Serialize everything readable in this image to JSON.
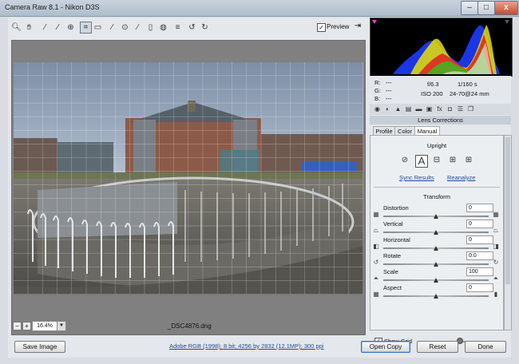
{
  "window": {
    "title": "Camera Raw 8.1  -  Nikon D3S",
    "minimize_label": "–",
    "maximize_label": "□",
    "close_label": "x"
  },
  "toolbar": {
    "tools": [
      "zoom-icon",
      "hand-icon",
      "white-balance-icon",
      "color-sampler-icon",
      "targeted-adjustment-icon",
      "crop-icon",
      "straighten-icon",
      "spot-removal-icon",
      "red-eye-icon",
      "adjustment-brush-icon",
      "graduated-filter-icon",
      "radial-filter-icon",
      "preferences-icon",
      "rotate-ccw-icon",
      "rotate-cw-icon"
    ],
    "preview_label": "Preview",
    "preview_checked": true
  },
  "image": {
    "zoom_value": "16.4%",
    "filename": "_DSC4876.dng"
  },
  "info": {
    "r_label": "R:",
    "r_value": "---",
    "g_label": "G:",
    "g_value": "---",
    "b_label": "B:",
    "b_value": "---",
    "aperture": "f/6.3",
    "shutter": "1/160 s",
    "iso": "ISO 200",
    "lens": "24-70@24 mm"
  },
  "panel": {
    "section_title": "Lens Corrections",
    "subtabs": [
      "Profile",
      "Color",
      "Manual"
    ],
    "active_subtab": "Manual",
    "upright_label": "Upright",
    "upright_active_label": "A",
    "sync_results": "Sync Results",
    "reanalyze": "Reanalyze",
    "transform_label": "Transform",
    "sliders": [
      {
        "name": "Distortion",
        "value": "0",
        "level": 0.5
      },
      {
        "name": "Vertical",
        "value": "0",
        "level": 0.5
      },
      {
        "name": "Horizontal",
        "value": "0",
        "level": 0.5
      },
      {
        "name": "Rotate",
        "value": "0.0",
        "level": 0.5
      },
      {
        "name": "Scale",
        "value": "100",
        "level": 0.5
      },
      {
        "name": "Aspect",
        "value": "0",
        "level": 0.5
      }
    ],
    "show_grid_label": "Show Grid",
    "show_grid_checked": true,
    "grid_size_level": 0.48
  },
  "footer": {
    "save_image": "Save Image",
    "workflow_link": "Adobe RGB (1998); 8 bit; 4256 by 2832 (12.1MP); 300 ppi",
    "open_copy": "Open Copy",
    "reset": "Reset",
    "done": "Done"
  },
  "colors": {
    "highlight_clip": "#e040e0",
    "accent_blue": "#1b4d9a"
  }
}
